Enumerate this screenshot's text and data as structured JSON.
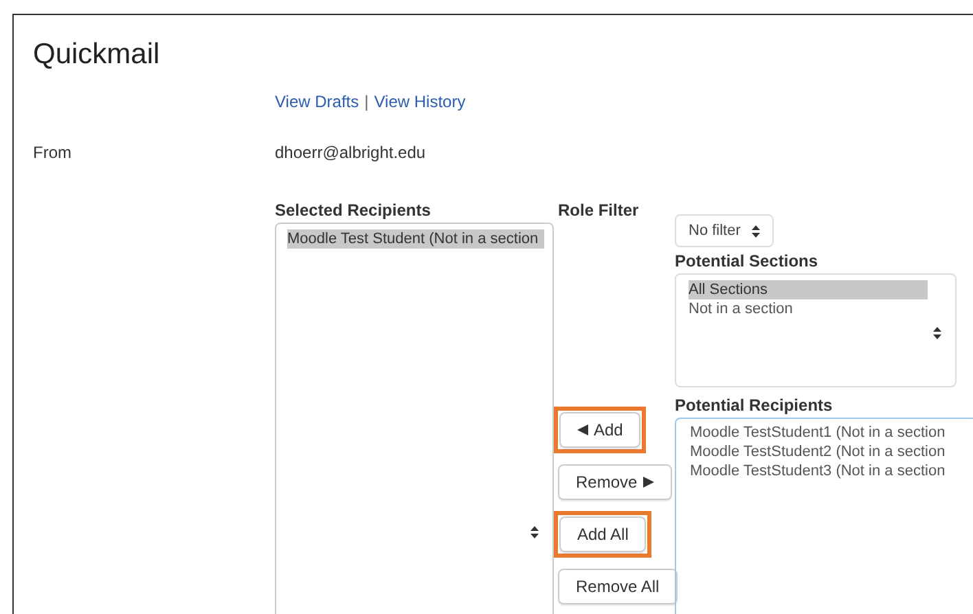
{
  "title": "Quickmail",
  "links": [
    "View Drafts",
    "View History"
  ],
  "link_separator": "|",
  "from": {
    "label": "From",
    "value": "dhoerr@albright.edu"
  },
  "selected_recipients": {
    "label": "Selected Recipients",
    "items": [
      {
        "text": "Moodle Test Student (Not in a section",
        "selected": true
      }
    ]
  },
  "role_filter": {
    "label": "Role Filter",
    "value": "No filter"
  },
  "potential_sections": {
    "label": "Potential Sections",
    "items": [
      {
        "text": "All Sections",
        "selected": true
      },
      {
        "text": "Not in a section",
        "selected": false
      }
    ]
  },
  "buttons": [
    {
      "label": "Add",
      "kind": "left",
      "highlighted": true
    },
    {
      "label": "Remove",
      "kind": "right",
      "highlighted": false
    },
    {
      "label": "Add All",
      "kind": "plain",
      "highlighted": true
    },
    {
      "label": "Remove All",
      "kind": "plain",
      "highlighted": false
    }
  ],
  "potential_recipients": {
    "label": "Potential Recipients",
    "items": [
      {
        "text": "Moodle TestStudent1 (Not in a section",
        "selected": false
      },
      {
        "text": "Moodle TestStudent2 (Not in a section",
        "selected": false
      },
      {
        "text": "Moodle TestStudent3 (Not in a section",
        "selected": false
      }
    ]
  }
}
